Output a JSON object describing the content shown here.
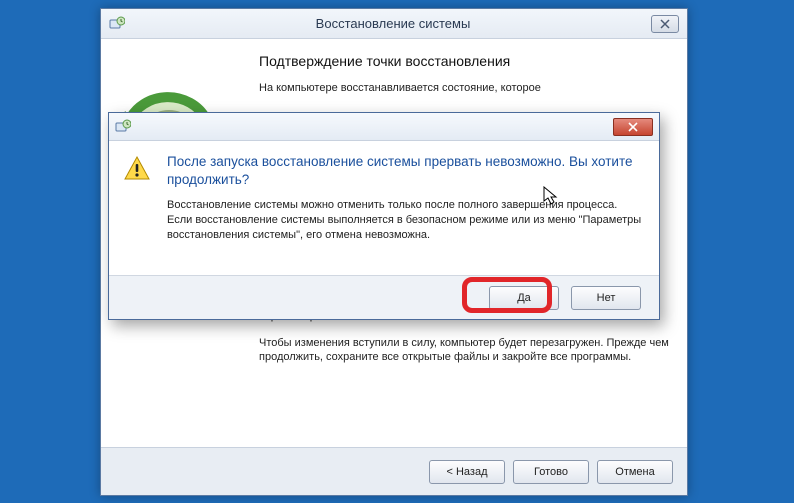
{
  "mainWindow": {
    "title": "Восстановление системы",
    "heading": "Подтверждение точки восстановления",
    "intro": "На компьютере восстанавливается состояние, которое",
    "note1": "Если вы недавно меняли пароль Windows, рекомендуем вам создать диск сброса пароля.",
    "note2": "Чтобы изменения вступили в силу, компьютер будет перезагружен. Прежде чем продолжить, сохраните все открытые файлы и закройте все программы.",
    "buttons": {
      "back": "< Назад",
      "finish": "Готово",
      "cancel": "Отмена"
    }
  },
  "dialog": {
    "heading": "После запуска восстановление системы прервать невозможно. Вы хотите продолжить?",
    "body": "Восстановление системы можно отменить только после полного завершения процесса. Если восстановление системы выполняется в безопасном режиме или из меню \"Параметры восстановления системы\", его отмена невозможна.",
    "yes": "Да",
    "no": "Нет"
  }
}
